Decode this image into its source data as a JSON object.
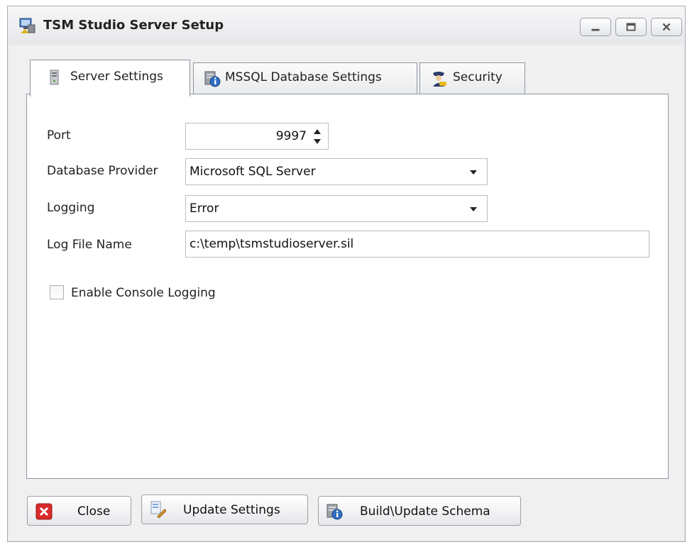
{
  "window": {
    "title": "TSM Studio Server Setup",
    "controls": [
      "minimize-icon",
      "maximize-icon",
      "close-icon"
    ]
  },
  "tabs": [
    {
      "label": "Server Settings",
      "icon": "server-icon",
      "active": true
    },
    {
      "label": "MSSQL Database Settings",
      "icon": "database-info-icon",
      "active": false
    },
    {
      "label": "Security",
      "icon": "security-officer-icon",
      "active": false
    }
  ],
  "form": {
    "port": {
      "label": "Port",
      "value": "9997"
    },
    "database_provider": {
      "label": "Database Provider",
      "value": "Microsoft SQL Server"
    },
    "logging": {
      "label": "Logging",
      "value": "Error"
    },
    "log_file_name": {
      "label": "Log File Name",
      "value": "c:\\temp\\tsmstudioserver.sil"
    },
    "console_logging": {
      "label": "Enable Console Logging",
      "checked": false
    }
  },
  "buttons": [
    {
      "label": "Close",
      "icon": "red-x-icon"
    },
    {
      "label": "Update Settings",
      "icon": "document-pencil-icon"
    },
    {
      "label": "Build\\Update Schema",
      "icon": "database-info-icon"
    }
  ],
  "colors": {
    "window_bg": "#f0f0f0",
    "panel_bg": "#ffffff",
    "close_icon_red": "#d92b2b"
  }
}
